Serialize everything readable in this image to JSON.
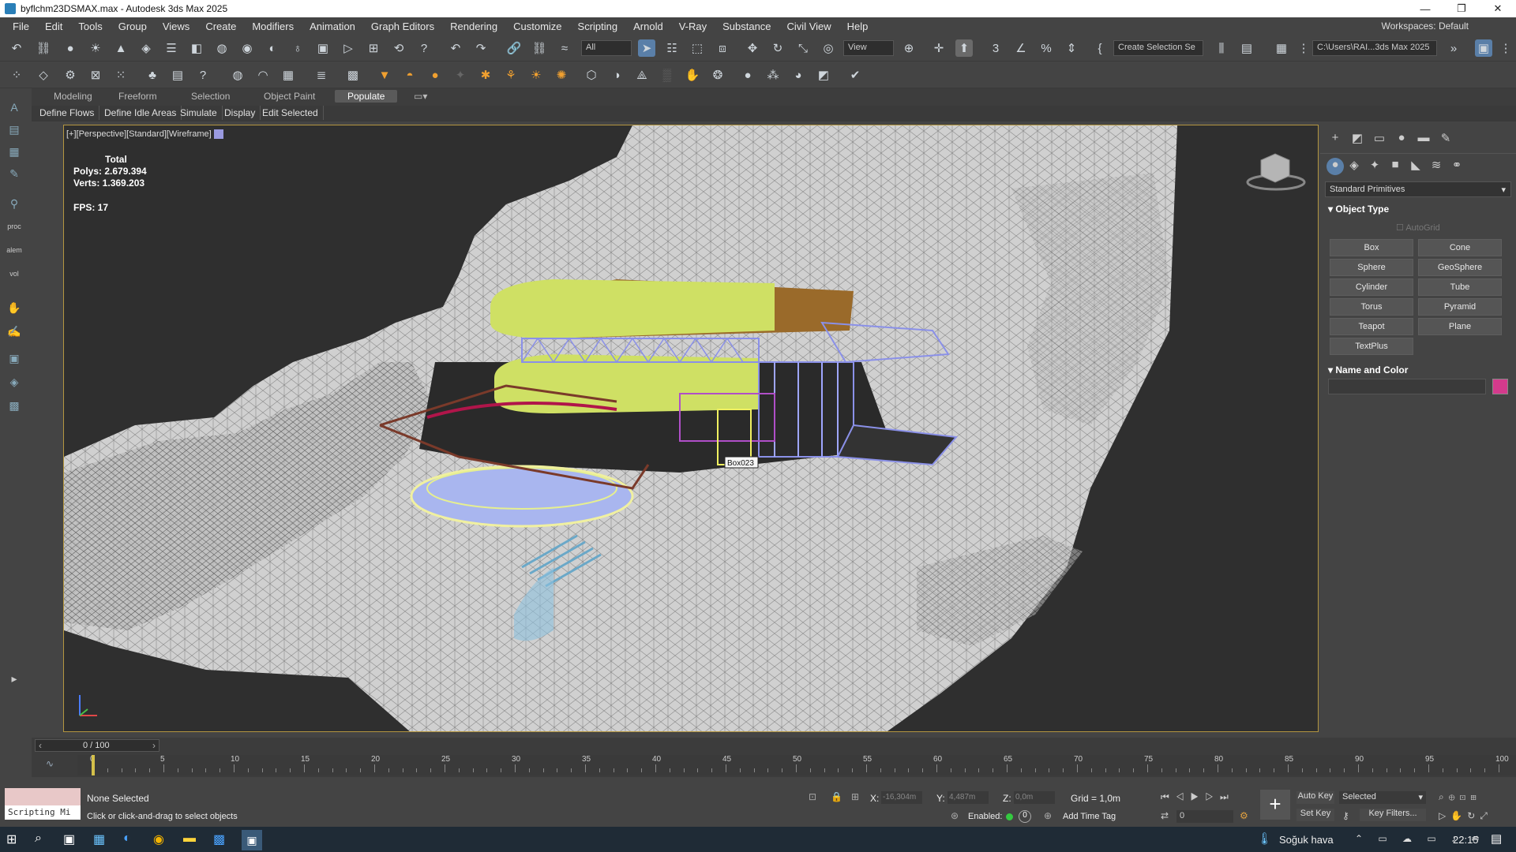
{
  "window": {
    "title": "byflchm23DSMAX.max - Autodesk 3ds Max 2025"
  },
  "menu": [
    "File",
    "Edit",
    "Tools",
    "Group",
    "Views",
    "Create",
    "Modifiers",
    "Animation",
    "Graph Editors",
    "Rendering",
    "Customize",
    "Scripting",
    "Arnold",
    "V-Ray",
    "Substance",
    "Civil View",
    "Help"
  ],
  "workspace": {
    "label": "Workspaces:",
    "value": "Default"
  },
  "toolbar": {
    "filter": "All",
    "ref_coord": "View",
    "selection_set": "Create Selection Se",
    "project_path": "C:\\Users\\RAI...3ds Max 2025"
  },
  "ribbon": {
    "tabs": [
      "Modeling",
      "Freeform",
      "Selection",
      "Object Paint",
      "Populate"
    ],
    "active": "Populate",
    "buttons": [
      "Define Flows",
      "Define Idle Areas",
      "Simulate",
      "Display",
      "Edit Selected"
    ]
  },
  "viewport": {
    "label": "[+][Perspective][Standard][Wireframe]",
    "stats_total": "Total",
    "polys": "Polys:  2.679.394",
    "verts": "Verts:  1.369.203",
    "fps": "FPS:     17",
    "tooltip": "Box023"
  },
  "left_labels": [
    "proc",
    "alem",
    "vol"
  ],
  "command_panel": {
    "category": "Standard Primitives",
    "object_type": "Object Type",
    "autogrid": "AutoGrid",
    "buttons": [
      "Box",
      "Cone",
      "Sphere",
      "GeoSphere",
      "Cylinder",
      "Tube",
      "Torus",
      "Pyramid",
      "Teapot",
      "Plane",
      "TextPlus"
    ],
    "name_color": "Name and Color",
    "color": "#d43a8c"
  },
  "timeline": {
    "frame": "0 / 100",
    "ticks": [
      "0",
      "5",
      "10",
      "15",
      "20",
      "25",
      "30",
      "35",
      "40",
      "45",
      "50",
      "55",
      "60",
      "65",
      "70",
      "75",
      "80",
      "85",
      "90",
      "95",
      "100"
    ]
  },
  "status": {
    "script": "Scripting Mi",
    "selection": "None Selected",
    "prompt": "Click or click-and-drag to select objects",
    "x_label": "X:",
    "x": "-16,304m",
    "y_label": "Y:",
    "y": "4,487m",
    "z_label": "Z:",
    "z": "0,0m",
    "grid": "Grid = 1,0m",
    "enabled": "Enabled:",
    "add_time_tag": "Add Time Tag",
    "auto_key": "Auto Key",
    "set_key": "Set Key",
    "selected": "Selected",
    "key_filters": "Key Filters...",
    "frame_value": "0"
  },
  "taskbar": {
    "weather": "Soğuk hava",
    "time": "22:15"
  }
}
